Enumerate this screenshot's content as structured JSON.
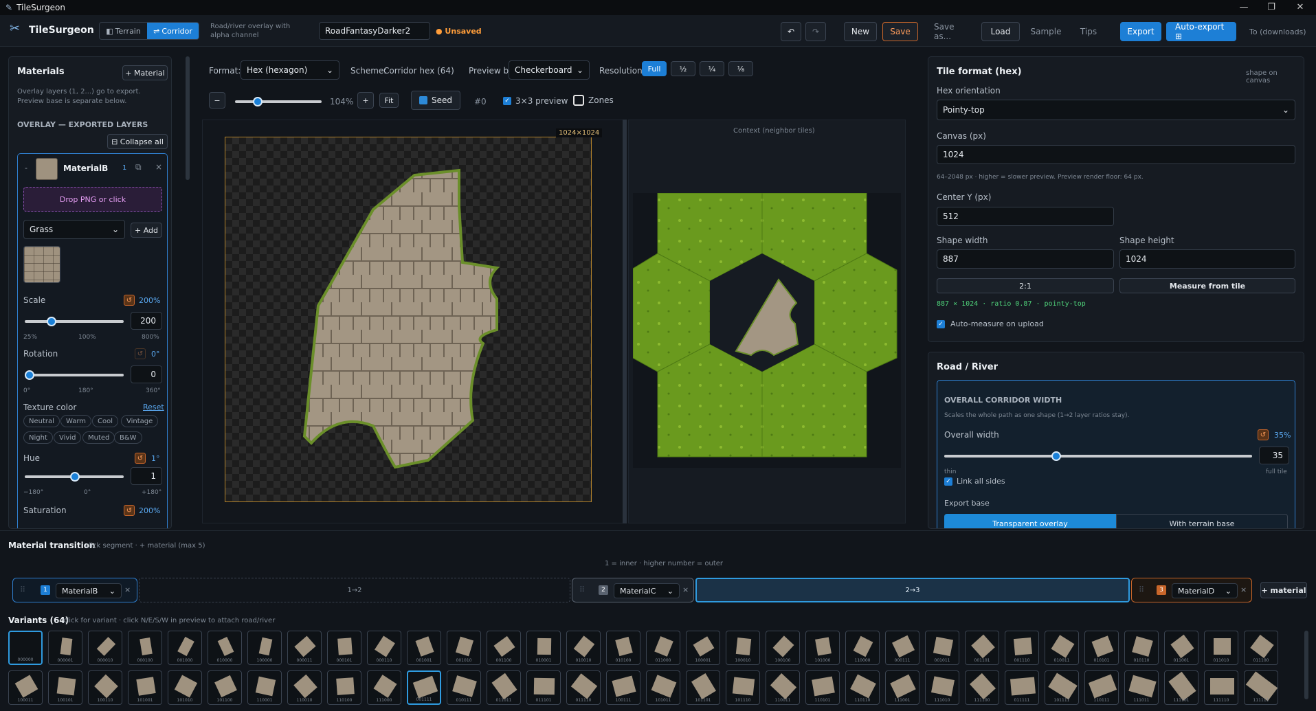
{
  "app": {
    "window_title": "TileSurgeon",
    "logo_text": "TileSurgeon"
  },
  "toolbar": {
    "mode_terrain": "Terrain",
    "mode_corridor": "Corridor",
    "mode_desc": "Road/river overlay with alpha channel",
    "project_name": "RoadFantasyDarker2",
    "unsaved": "● Unsaved",
    "new": "New",
    "save": "Save",
    "save_as": "Save as...",
    "load": "Load",
    "sample": "Sample",
    "tips": "Tips",
    "export": "Export",
    "auto_export": "Auto-export ⊞",
    "to_downloads": "To (downloads)",
    "undo": "↶",
    "redo": "↷"
  },
  "materials": {
    "title": "Materials",
    "add_material": "+ Material",
    "desc": "Overlay layers (1, 2...) go to export. Preview base is separate below.",
    "section": "OVERLAY — EXPORTED LAYERS",
    "collapse_all": "⊟ Collapse all",
    "card": {
      "collapse": "-",
      "name": "MaterialB",
      "index": "1",
      "dup": "⧉",
      "close": "×",
      "drop": "Drop PNG or click",
      "base_select": "Grass",
      "add": "+ Add",
      "scale_label": "Scale",
      "scale_pct": "200%",
      "scale_value": "200",
      "scale_ticks": [
        "25%",
        "100%",
        "800%"
      ],
      "rotation_label": "Rotation",
      "rotation_deg": "0°",
      "rotation_value": "0",
      "rotation_ticks": [
        "0°",
        "180°",
        "360°"
      ],
      "texcolor_label": "Texture color",
      "texcolor_reset": "Reset",
      "presets": [
        "Neutral",
        "Warm",
        "Cool",
        "Vintage",
        "Night",
        "Vivid",
        "Muted",
        "B&W"
      ],
      "hue_label": "Hue",
      "hue_deg": "1°",
      "hue_value": "1",
      "hue_ticks": [
        "−180°",
        "0°",
        "+180°"
      ],
      "saturation_label": "Saturation",
      "saturation_pct": "200%"
    }
  },
  "preview": {
    "format_label": "Format:",
    "format_value": "Hex (hexagon)",
    "scheme_label": "Scheme:",
    "scheme_value": "Corridor hex (64)",
    "base_label": "Preview base:",
    "base_value": "Checkerboard",
    "resolution_label": "Resolution",
    "res_options": [
      "Full",
      "½",
      "¼",
      "⅛"
    ],
    "zoom_minus": "−",
    "zoom_pct": "104%",
    "zoom_plus": "+",
    "fit": "Fit",
    "seed": "Seed",
    "seed_num": "#0",
    "preview3x3": "3×3 preview",
    "zones": "Zones",
    "canvas_size": "1024×1024",
    "context_label": "Context (neighbor tiles)"
  },
  "tile_format": {
    "title": "Tile format (hex)",
    "hint": "shape on canvas",
    "orientation_label": "Hex orientation",
    "orientation_value": "Pointy-top",
    "canvas_label": "Canvas (px)",
    "canvas_value": "1024",
    "canvas_hint": "64–2048 px · higher = slower preview. Preview render floor: 64 px.",
    "centery_label": "Center Y (px)",
    "centery_value": "512",
    "width_label": "Shape width",
    "width_value": "887",
    "height_label": "Shape height",
    "height_value": "1024",
    "ratio_btn": "2:1",
    "measure_btn": "Measure from tile",
    "measure_readout": "887 × 1024 · ratio 0.87 · pointy-top",
    "automeasure": "Auto-measure on upload"
  },
  "road": {
    "title": "Road / River",
    "section": "OVERALL CORRIDOR WIDTH",
    "desc": "Scales the whole path as one shape (1→2 layer ratios stay).",
    "width_label": "Overall width",
    "width_pct": "35%",
    "width_value": "35",
    "thin": "thin",
    "full": "full tile",
    "link": "Link all sides",
    "export_base": "Export base",
    "transparent": "Transparent overlay",
    "with_terrain": "With terrain base"
  },
  "transition": {
    "title": "Material transition",
    "hint": "click segment · + material (max 5)",
    "order": "1 = inner · higher number = outer",
    "m1": {
      "num": "1",
      "name": "MaterialB"
    },
    "seg12": "1→2",
    "m2": {
      "num": "2",
      "name": "MaterialC"
    },
    "seg23": "2→3",
    "m3": {
      "num": "3",
      "name": "MaterialD"
    },
    "add": "+ material",
    "drag": "⠿",
    "close": "×"
  },
  "variants": {
    "title": "Variants (64)",
    "hint": "click for variant · click N/E/S/W in preview to attach road/river",
    "row1": [
      "000000",
      "000001",
      "000010",
      "000100",
      "001000",
      "010000",
      "100000",
      "000011",
      "000101",
      "000110",
      "001001",
      "001010",
      "001100",
      "010001",
      "010010",
      "010100",
      "011000",
      "100001",
      "100010",
      "100100",
      "101000",
      "110000",
      "000111",
      "001011",
      "001101",
      "001110",
      "010011",
      "010101",
      "010110",
      "011001",
      "011010",
      "011100"
    ],
    "row2": [
      "100011",
      "100101",
      "100110",
      "101001",
      "101010",
      "101100",
      "110001",
      "110010",
      "110100",
      "111000",
      "001111",
      "010111",
      "011011",
      "011101",
      "011110",
      "100111",
      "101011",
      "101101",
      "101110",
      "110011",
      "110101",
      "110110",
      "111001",
      "111010",
      "111100",
      "011111",
      "101111",
      "110111",
      "111011",
      "111101",
      "111110",
      "111111"
    ]
  }
}
